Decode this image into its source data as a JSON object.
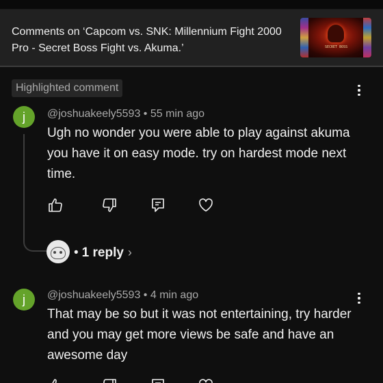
{
  "header": {
    "title": "Comments on ‘Capcom vs. SNK: Millennium Fight 2000 Pro - Secret Boss Fight vs. Akuma.’",
    "thumbnail_caption": "SECRET BOSS"
  },
  "highlighted_label": "Highlighted comment",
  "comments": [
    {
      "avatar_letter": "j",
      "avatar_color": "#64a32a",
      "author": "@joshuakeely5593",
      "separator": "•",
      "time": "55 min ago",
      "text": "Ugh no wonder you were able to play against akuma you have it on easy mode. try on hardest mode next time.",
      "reply_separator": "•",
      "reply_count": "1 reply"
    },
    {
      "avatar_letter": "j",
      "avatar_color": "#64a32a",
      "author": "@joshuakeely5593",
      "separator": "•",
      "time": "4 min ago",
      "text": "That may be so but it was not entertaining, try harder and you may get more views be safe and have an awesome day"
    }
  ],
  "icons": {
    "like": "thumbs-up-icon",
    "dislike": "thumbs-down-icon",
    "reply": "reply-comment-icon",
    "heart": "heart-icon",
    "more": "more-vertical-icon",
    "chevron": "chevron-right-icon"
  },
  "colors": {
    "background": "#0f0f0f",
    "header_background": "#212121",
    "text_primary": "#f1f1f1",
    "text_secondary": "#aaaaaa",
    "avatar": "#64a32a"
  }
}
